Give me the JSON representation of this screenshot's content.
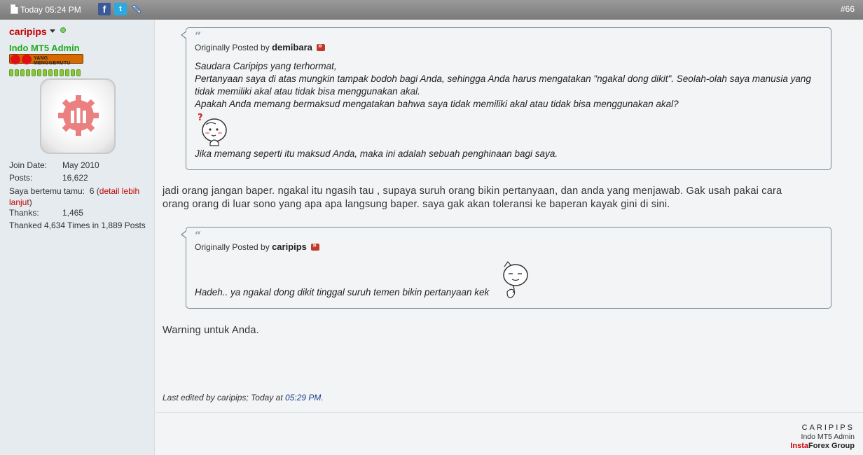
{
  "header": {
    "date": "Today 05:24 PM",
    "post_number": "#66",
    "share": {
      "facebook": "f",
      "twitter": "t"
    }
  },
  "user": {
    "username": "caripips",
    "title": "Indo MT5 Admin",
    "rank_badge_text": "YANG MENGGERUTU",
    "stats": {
      "join_label": "Join Date:",
      "join_value": "May 2010",
      "posts_label": "Posts:",
      "posts_value": "16,622",
      "met_label": "Saya bertemu tamu:",
      "met_value": "6",
      "met_link": "detail lebih lanjut",
      "thanks_label": "Thanks:",
      "thanks_value": "1,465",
      "thanked_text": "Thanked 4,634 Times in 1,889 Posts"
    }
  },
  "quotes": [
    {
      "posted_by_prefix": "Originally Posted by",
      "author": "demibara",
      "lines": [
        "Saudara Caripips yang terhormat,",
        "Pertanyaan saya di atas mungkin tampak bodoh bagi Anda, sehingga Anda harus mengatakan \"ngakal dong dikit\". Seolah-olah saya manusia yang",
        "tidak memiliki akal atau tidak bisa menggunakan akal.",
        "Apakah Anda memang bermaksud mengatakan bahwa saya tidak memiliki akal atau tidak bisa menggunakan akal?",
        "Jika memang seperti itu maksud Anda, maka ini adalah sebuah penghinaan bagi saya."
      ]
    },
    {
      "posted_by_prefix": "Originally Posted by",
      "author": "caripips",
      "lines": [
        "Hadeh.. ya ngakal dong dikit tinggal suruh temen bikin pertanyaan kek"
      ]
    }
  ],
  "messages": [
    "jadi orang jangan baper. ngakal itu ngasih tau , supaya suruh orang bikin pertanyaan, dan anda yang menjawab. Gak usah pakai cara",
    "orang orang di luar sono yang apa apa langsung baper. saya gak akan toleransi ke baperan kayak gini di sini.",
    "Warning untuk Anda."
  ],
  "last_edited": {
    "prefix": "Last edited by caripips; Today at",
    "time": "05:29 PM",
    "suffix": "."
  },
  "signature": {
    "name": "CARIPIPS",
    "title": "Indo MT5 Admin",
    "brand_insta": "Insta",
    "brand_rest": "Forex Group"
  },
  "colors": {
    "username": "#c00000",
    "usertitle": "#22aa22",
    "header_bar": "#8a8a8a",
    "edit_time": "#1b3f8a"
  }
}
